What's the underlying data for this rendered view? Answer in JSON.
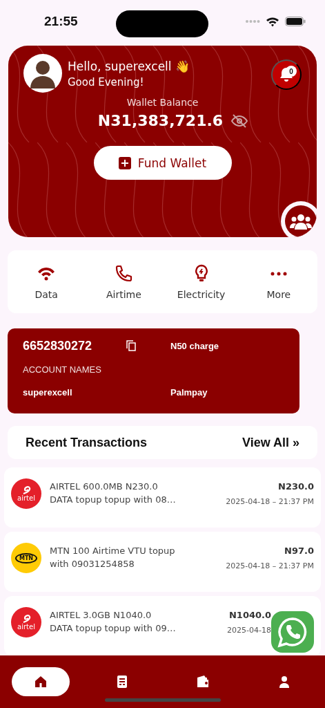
{
  "status_bar": {
    "time": "21:55"
  },
  "header": {
    "greeting": "Hello, superexcell 👋",
    "subtitle": "Good Evening!",
    "notification_count": "0",
    "balance_label": "Wallet Balance",
    "balance": "N31,383,721.6",
    "fund_button": "Fund Wallet"
  },
  "quick_actions": [
    {
      "kind": "data",
      "label": "Data"
    },
    {
      "kind": "airtime",
      "label": "Airtime"
    },
    {
      "kind": "electricity",
      "label": "Electricity"
    },
    {
      "kind": "more",
      "label": "More"
    }
  ],
  "account": {
    "number": "6652830272",
    "charge": "N50 charge",
    "names_label": "ACCOUNT NAMES",
    "name": "superexcell",
    "bank": "Palmpay"
  },
  "recent": {
    "title": "Recent Transactions",
    "view_all": "View All »"
  },
  "transactions": [
    {
      "kind": "airtel",
      "logo_text": "airtel",
      "description": "AIRTEL 600.0MB   N230.0\nDATA topup topup  with 08…",
      "amount": "N230.0",
      "date": "2025-04-18 – 21:37 PM"
    },
    {
      "kind": "mtn",
      "logo_text": "MTN",
      "description": "MTN 100 Airtime VTU topup\nwith 09031254858",
      "amount": "N97.0",
      "date": "2025-04-18 – 21:37 PM"
    },
    {
      "kind": "airtel",
      "logo_text": "airtel",
      "description": "AIRTEL 3.0GB   N1040.0\nDATA topup topup  with 09…",
      "amount": "N1040.0",
      "date": "2025-04-18"
    }
  ],
  "nav": [
    {
      "kind": "home",
      "selected": true
    },
    {
      "kind": "receipt",
      "selected": false
    },
    {
      "kind": "wallet",
      "selected": false
    },
    {
      "kind": "profile",
      "selected": false
    }
  ]
}
